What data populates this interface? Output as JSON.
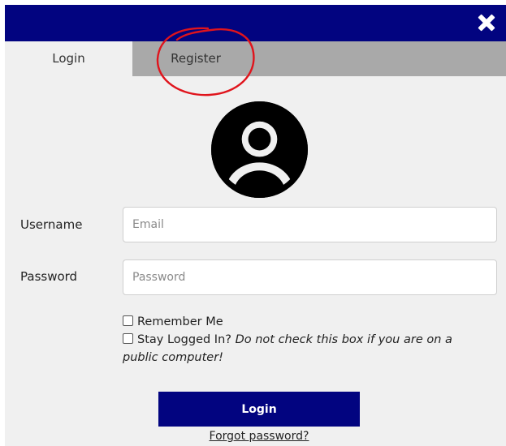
{
  "dialog": {
    "close_icon": "close-icon",
    "header_color": "#020480"
  },
  "tabs": [
    {
      "label": "Login",
      "active": true
    },
    {
      "label": "Register",
      "active": false
    }
  ],
  "annotation": {
    "shape": "hand-drawn circle",
    "color": "#e0141c"
  },
  "avatar": {
    "icon": "user-avatar-icon"
  },
  "form": {
    "username_label": "Username",
    "username_placeholder": "Email",
    "password_label": "Password",
    "password_placeholder": "Password",
    "remember_me_label": "Remember Me",
    "stay_logged_in_label": "Stay Logged In?",
    "stay_logged_in_note": "Do not check this box if you are on a public computer!",
    "login_button": "Login",
    "forgot_password": "Forgot password?"
  }
}
